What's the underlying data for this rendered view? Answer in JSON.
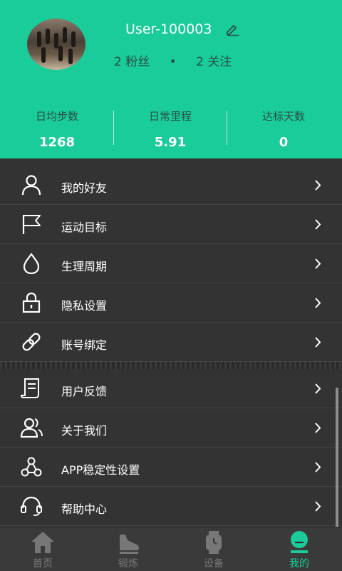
{
  "profile": {
    "username": "User-100003",
    "fans_count": "2",
    "fans_label": "粉丝",
    "dot": "•",
    "follow_count": "2",
    "follow_label": "关注"
  },
  "stats": [
    {
      "label": "日均步数",
      "value": "1268"
    },
    {
      "label": "日常里程",
      "value": "5.91"
    },
    {
      "label": "达标天数",
      "value": "0"
    }
  ],
  "menu": [
    {
      "label": "我的好友",
      "icon": "user-icon"
    },
    {
      "label": "运动目标",
      "icon": "flag-icon"
    },
    {
      "label": "生理周期",
      "icon": "drop-icon"
    },
    {
      "label": "隐私设置",
      "icon": "lock-icon"
    },
    {
      "label": "账号绑定",
      "icon": "link-icon"
    },
    {
      "label": "用户反馈",
      "icon": "feedback-icon"
    },
    {
      "label": "关于我们",
      "icon": "users-icon"
    },
    {
      "label": "APP稳定性设置",
      "icon": "network-icon"
    },
    {
      "label": "帮助中心",
      "icon": "headset-icon"
    }
  ],
  "tabs": [
    {
      "label": "首页",
      "icon": "home-icon"
    },
    {
      "label": "锻炼",
      "icon": "shoe-icon"
    },
    {
      "label": "设备",
      "icon": "watch-icon"
    },
    {
      "label": "我的",
      "icon": "profile-icon",
      "active": true
    }
  ],
  "colors": {
    "accent": "#19cc99",
    "background": "#333333",
    "tab_inactive": "#777777"
  }
}
